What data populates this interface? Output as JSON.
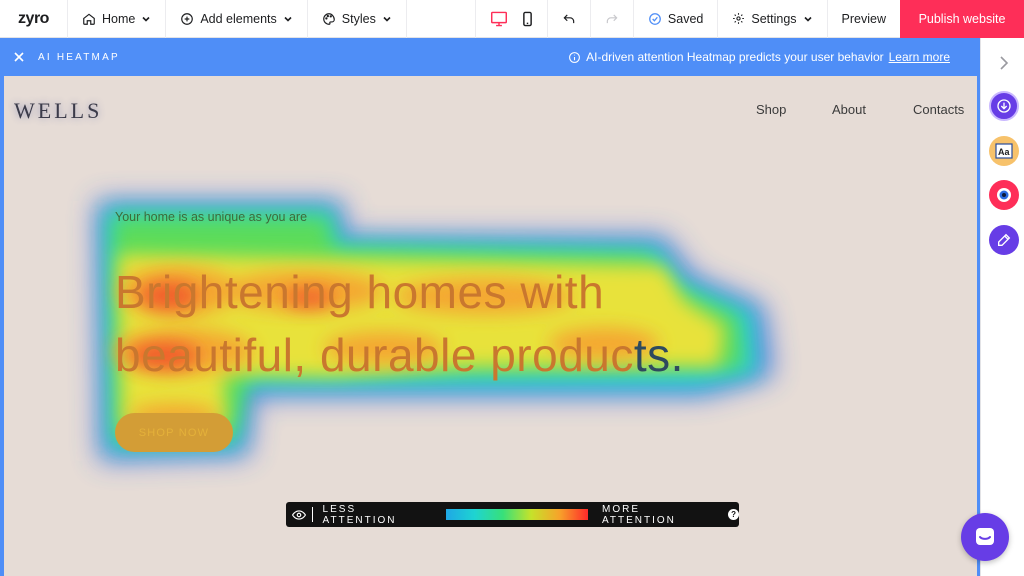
{
  "app": {
    "logo": "zyro"
  },
  "toolbar": {
    "home_label": "Home",
    "add_label": "Add elements",
    "styles_label": "Styles",
    "saved_label": "Saved",
    "settings_label": "Settings",
    "preview_label": "Preview",
    "publish_label": "Publish website"
  },
  "banner": {
    "title": "AI HEATMAP",
    "info_text": "AI-driven attention Heatmap predicts your user behavior",
    "learn_more": "Learn more"
  },
  "site": {
    "logo": "WELLS",
    "nav": [
      "Shop",
      "About",
      "Contacts"
    ],
    "tagline": "Your home is as unique as you are",
    "headline_line1": "Brightening homes with",
    "headline_line2a": "beautiful, durable produc",
    "headline_line2b": "ts.",
    "cta": "SHOP NOW"
  },
  "legend": {
    "less": "LESS ATTENTION",
    "more": "MORE ATTENTION",
    "help": "?"
  },
  "colors": {
    "accent_blue": "#4f8ef7",
    "publish_red": "#fe2e58",
    "purple": "#673de6"
  },
  "icons": [
    "home-icon",
    "plus-circle-icon",
    "palette-icon",
    "desktop-icon",
    "mobile-icon",
    "undo-icon",
    "redo-icon",
    "check-circle-icon",
    "gear-icon",
    "close-icon",
    "info-icon",
    "eye-icon",
    "chevron-right-icon",
    "download-icon",
    "typography-icon",
    "heatmap-eye-icon",
    "edit-icon",
    "chat-icon"
  ]
}
